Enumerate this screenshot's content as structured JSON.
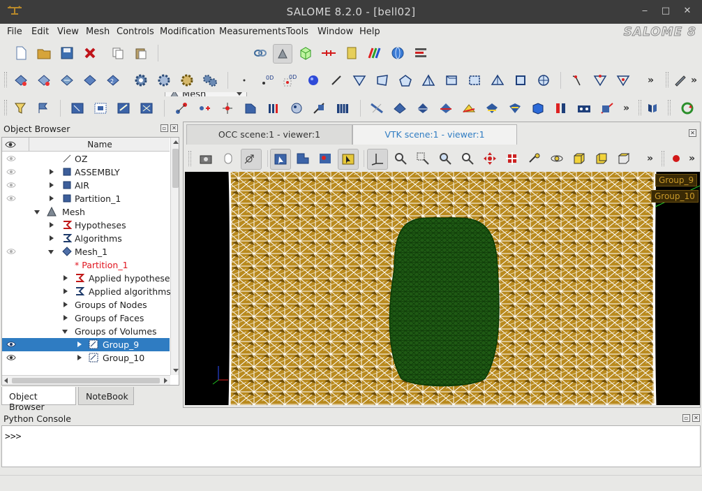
{
  "window": {
    "title": "SALOME 8.2.0 - [bell02]",
    "minimize": "‒",
    "maximize": "□",
    "close": "✕"
  },
  "menu": {
    "items": [
      {
        "label": "File"
      },
      {
        "label": "Edit"
      },
      {
        "label": "View"
      },
      {
        "label": "Mesh"
      },
      {
        "label": "Controls"
      },
      {
        "label": "Modification"
      },
      {
        "label": "Measurements"
      },
      {
        "label": "Tools"
      },
      {
        "label": "Window"
      },
      {
        "label": "Help"
      }
    ],
    "brand": "SALOME 8"
  },
  "toolbar": {
    "module_combo": "Mesh",
    "more": "»"
  },
  "object_browser": {
    "title": "Object Browser",
    "column_name": "Name",
    "rows": [
      {
        "label": "OZ"
      },
      {
        "label": "ASSEMBLY"
      },
      {
        "label": "AIR"
      },
      {
        "label": "Partition_1"
      },
      {
        "label": "Mesh"
      },
      {
        "label": "Hypotheses"
      },
      {
        "label": "Algorithms"
      },
      {
        "label": "Mesh_1"
      },
      {
        "label": "* Partition_1"
      },
      {
        "label": "Applied hypotheses"
      },
      {
        "label": "Applied algorithms"
      },
      {
        "label": "Groups of Nodes"
      },
      {
        "label": "Groups of Faces"
      },
      {
        "label": "Groups of Volumes"
      },
      {
        "label": "Group_9"
      },
      {
        "label": "Group_10"
      }
    ],
    "selected": "Group_9",
    "tabs": [
      {
        "label": "Object Browser"
      },
      {
        "label": "NoteBook"
      }
    ]
  },
  "viewer": {
    "tabs": [
      {
        "label": "OCC scene:1 - viewer:1"
      },
      {
        "label": "VTK scene:1 - viewer:1"
      }
    ],
    "active_tab": "VTK scene:1 - viewer:1",
    "group_labels": [
      "Group_9",
      "Group_10"
    ],
    "colors": {
      "outer_mesh": "#b98a1e",
      "inner_mesh": "#1f5a14",
      "wire": "#ffffff",
      "background": "#000000"
    }
  },
  "console": {
    "title": "Python Console",
    "prompt": ">>>"
  },
  "colors": {
    "titlebar": "#3c3c3c",
    "selection": "#2f7cc2",
    "active_tab_text": "#2f7cc2",
    "partition_text": "#e0151f"
  }
}
